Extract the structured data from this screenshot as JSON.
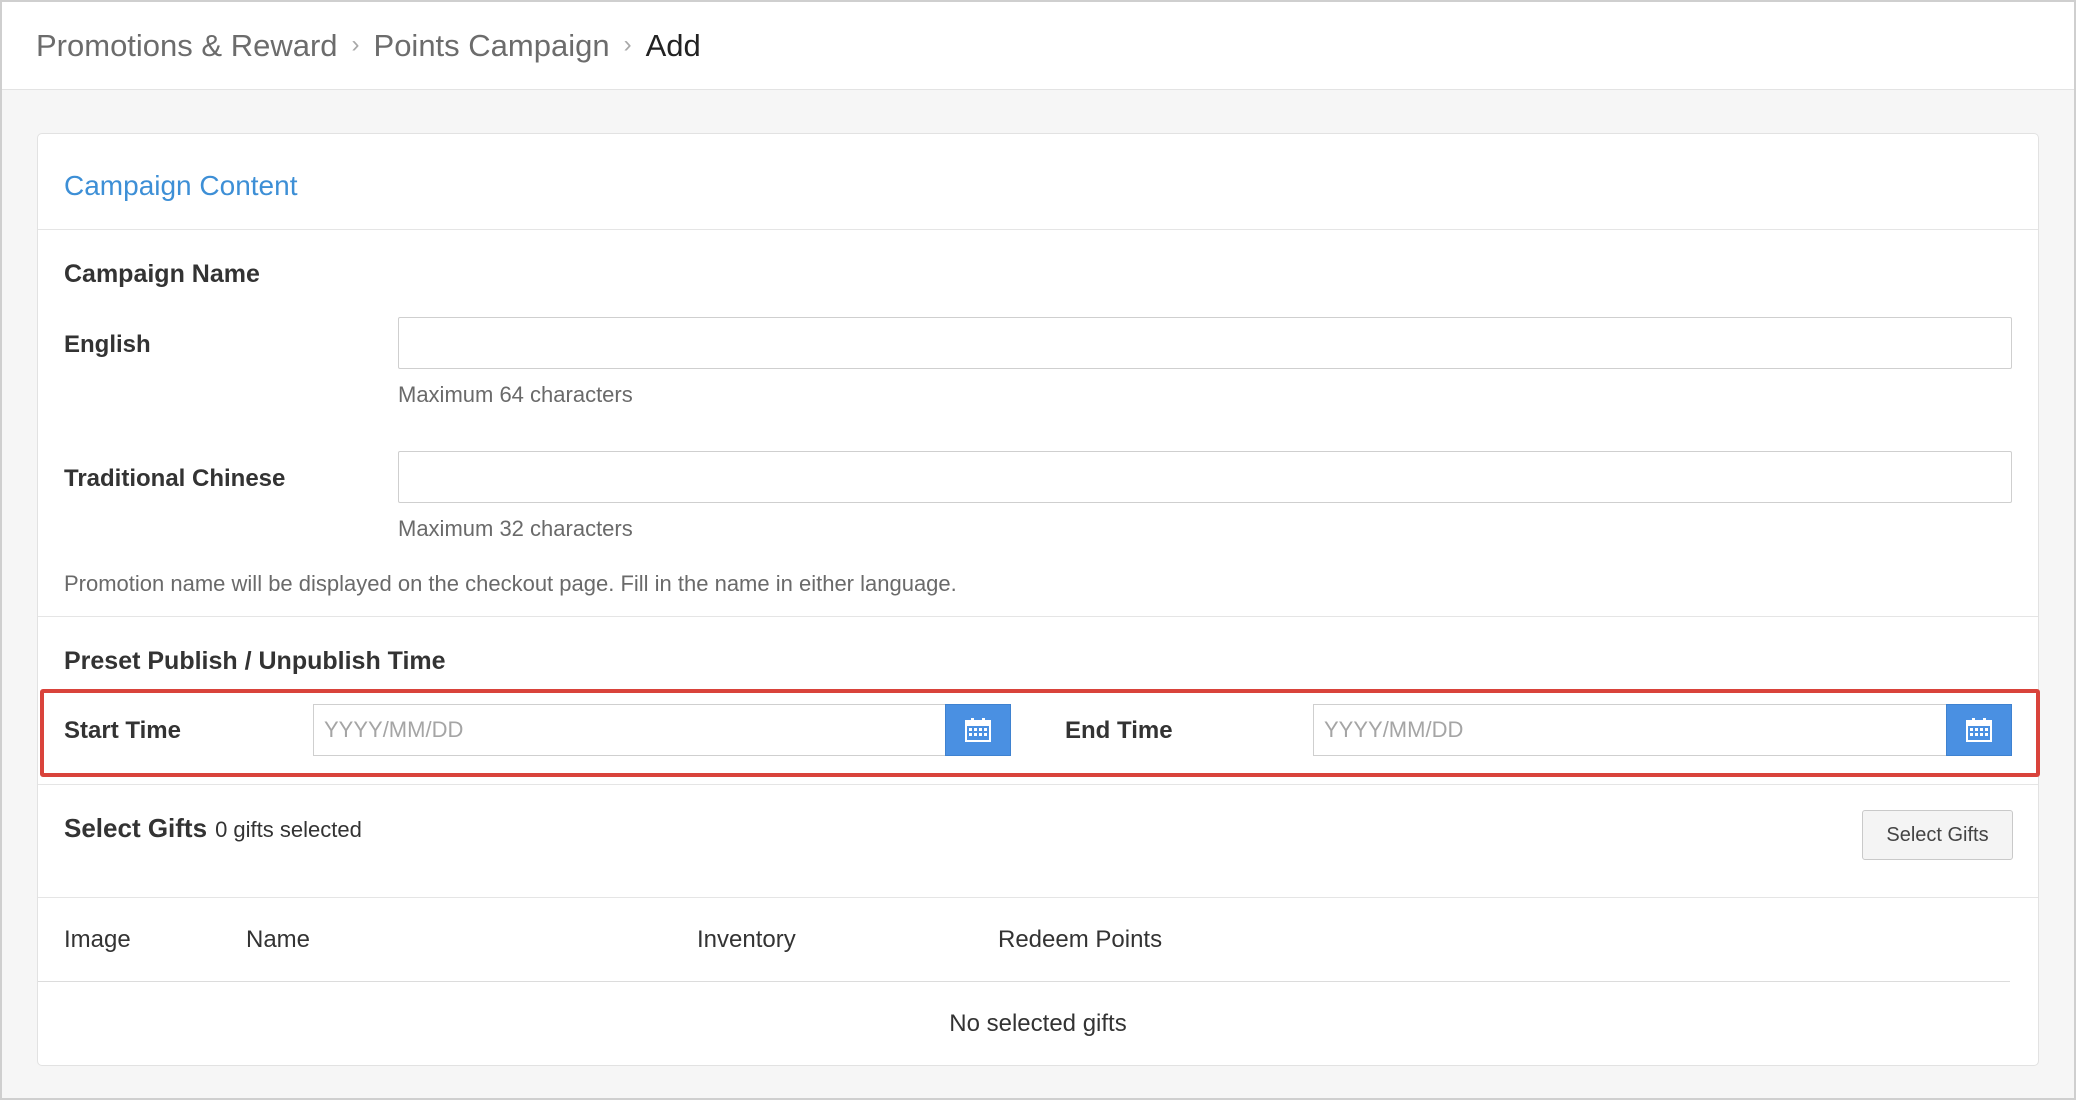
{
  "breadcrumb": {
    "items": [
      "Promotions & Reward",
      "Points Campaign",
      "Add"
    ],
    "separator": "›"
  },
  "campaign_content": {
    "title": "Campaign Content",
    "name_group_title": "Campaign Name",
    "english_label": "English",
    "english_value": "",
    "english_help": "Maximum 64 characters",
    "chinese_label": "Traditional Chinese",
    "chinese_value": "",
    "chinese_help": "Maximum 32 characters",
    "name_note": "Promotion name will be displayed on the checkout page. Fill in the name in either language."
  },
  "publish_time": {
    "title": "Preset Publish / Unpublish Time",
    "start_label": "Start Time",
    "start_placeholder": "YYYY/MM/DD",
    "end_label": "End Time",
    "end_placeholder": "YYYY/MM/DD",
    "highlight_color": "#d9433b",
    "calendar_button_color": "#4a90e2"
  },
  "gifts": {
    "title": "Select Gifts",
    "count_text": "0 gifts selected",
    "button_label": "Select Gifts",
    "columns": [
      "Image",
      "Name",
      "Inventory",
      "Redeem Points"
    ],
    "empty_text": "No selected gifts"
  },
  "colors": {
    "accent": "#3d8fd6"
  }
}
